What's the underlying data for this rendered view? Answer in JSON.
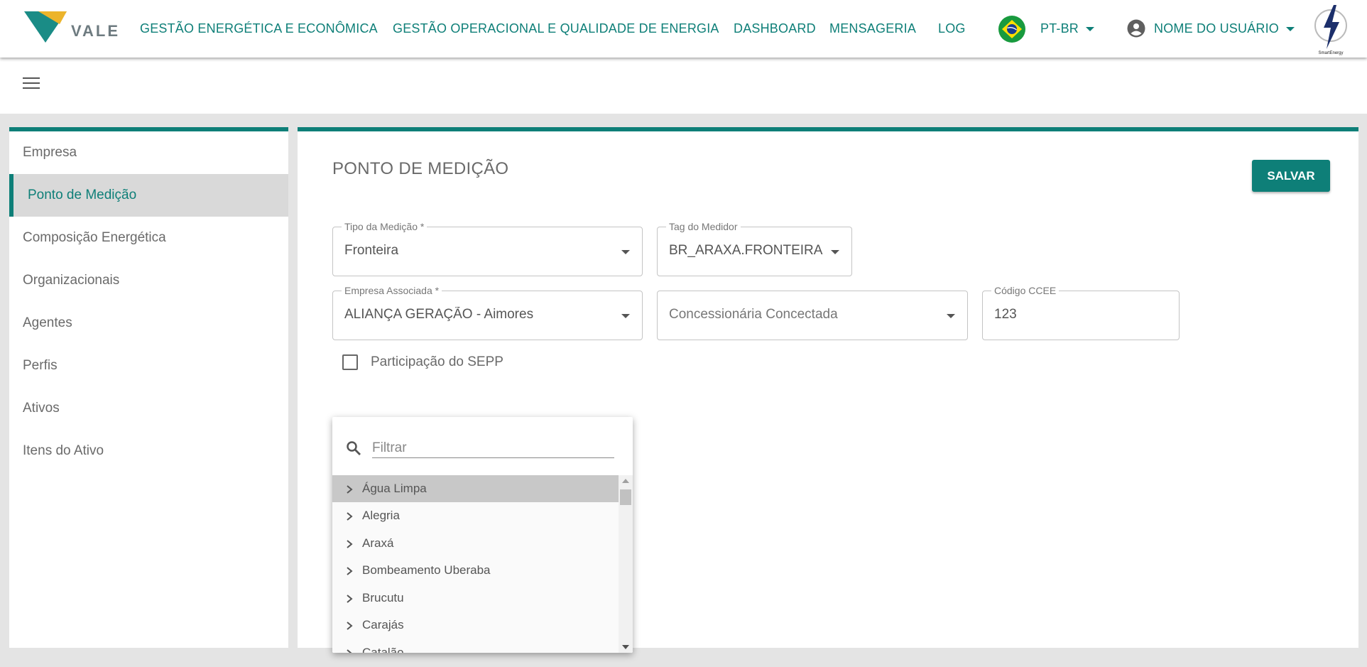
{
  "brand": {
    "name": "VALE",
    "partner_logo_text": "SmartEnergy"
  },
  "nav": {
    "items": [
      "GESTÃO ENERGÉTICA E ECONÔMICA",
      "GESTÃO OPERACIONAL E QUALIDADE DE ENERGIA",
      "DASHBOARD",
      "MENSAGERIA",
      "LOG"
    ],
    "language": "PT-BR",
    "user": "NOME DO USUÁRIO"
  },
  "sidebar": {
    "items": [
      {
        "label": "Empresa"
      },
      {
        "label": "Ponto de Medição",
        "active": true
      },
      {
        "label": "Composição Energética"
      },
      {
        "label": "Organizacionais"
      },
      {
        "label": "Agentes"
      },
      {
        "label": "Perfis"
      },
      {
        "label": "Ativos"
      },
      {
        "label": "Itens do Ativo"
      }
    ]
  },
  "main": {
    "title": "PONTO DE MEDIÇÃO",
    "save_label": "SALVAR",
    "fields": {
      "tipo_medicao": {
        "label": "Tipo da Medição *",
        "value": "Fronteira"
      },
      "tag_medidor": {
        "label": "Tag do Medidor",
        "value": "BR_ARAXA.FRONTEIRA"
      },
      "empresa_associada": {
        "label": "Empresa Associada *",
        "value": "ALIANÇA GERAÇÃO - Aimores"
      },
      "concessionaria": {
        "placeholder": "Concessionária Concectada"
      },
      "codigo_ccee": {
        "label": "Código CCEE",
        "value": "123"
      }
    },
    "checkbox": {
      "label": "Participação do SEPP",
      "checked": false
    }
  },
  "dropdown": {
    "filter_placeholder": "Filtrar",
    "items": [
      "Água Limpa",
      "Alegria",
      "Araxá",
      "Bombeamento Uberaba",
      "Brucutu",
      "Carajás",
      "Catalão"
    ],
    "highlighted_index": 0
  },
  "colors": {
    "accent": "#0e7f78",
    "background": "#e4e4e4",
    "active_item": "#d9d9d9"
  },
  "icons": [
    "menu-icon",
    "brazil-flag-icon",
    "account-circle-icon",
    "search-icon",
    "chevron-right-icon",
    "dropdown-arrow-icon"
  ]
}
